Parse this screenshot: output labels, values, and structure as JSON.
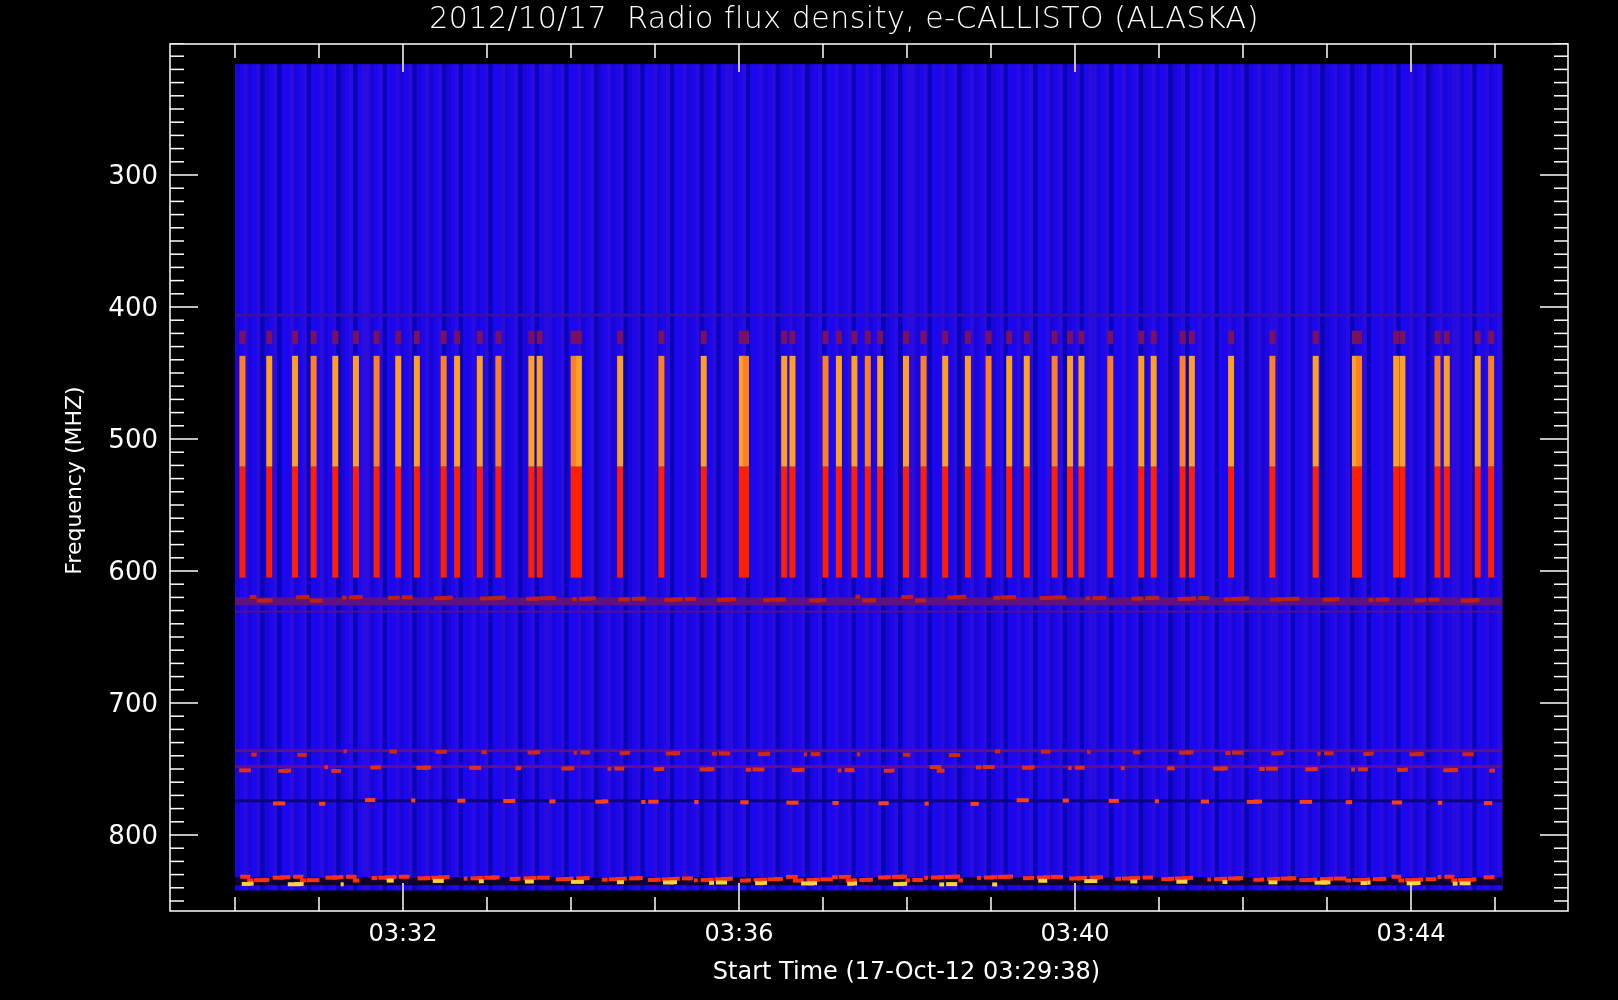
{
  "title": "2012/10/17  Radio flux density, e-CALLISTO (ALASKA)",
  "y_axis": {
    "label": "Frequency (MHZ)",
    "ticks": [
      "300",
      "400",
      "500",
      "600",
      "700",
      "800"
    ]
  },
  "x_axis": {
    "label": "Start Time (17-Oct-12 03:29:38)",
    "ticks": [
      "03:32",
      "03:36",
      "03:40",
      "03:44"
    ]
  }
}
